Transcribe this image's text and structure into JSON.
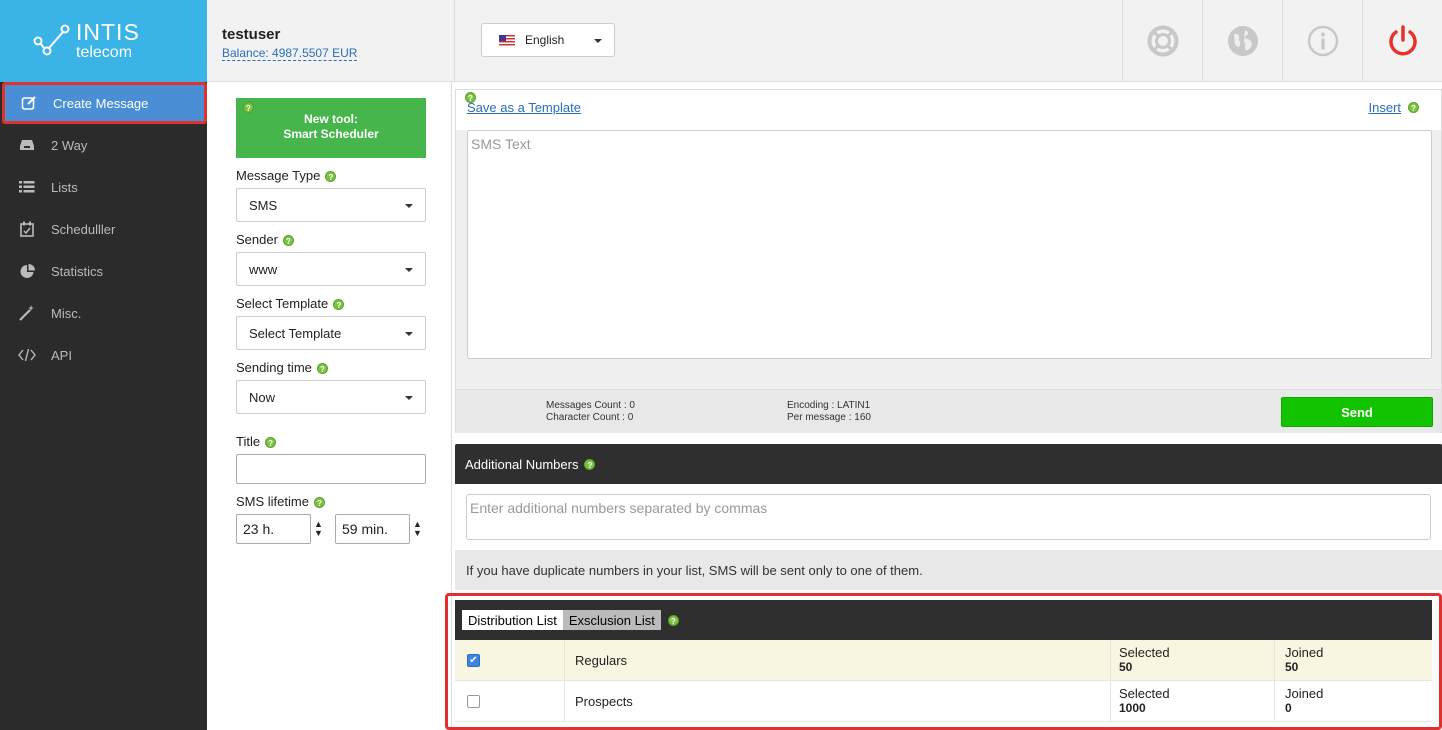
{
  "brand": {
    "name_line1": "INTIS",
    "name_line2": "telecom"
  },
  "sidebar": {
    "items": [
      {
        "label": "Create Message",
        "icon": "edit-icon"
      },
      {
        "label": "2 Way",
        "icon": "inbox-icon"
      },
      {
        "label": "Lists",
        "icon": "list-icon"
      },
      {
        "label": "Schedulller",
        "icon": "calendar-icon"
      },
      {
        "label": "Statistics",
        "icon": "pie-chart-icon"
      },
      {
        "label": "Misc.",
        "icon": "magic-wand-icon"
      },
      {
        "label": "API",
        "icon": "code-icon"
      }
    ]
  },
  "header": {
    "username": "testuser",
    "balance": "Balance: 4987.5507 EUR",
    "language": "English",
    "icons": [
      "lifebuoy-icon",
      "globe-icon",
      "info-icon",
      "power-icon"
    ]
  },
  "form": {
    "promo_line1": "New tool:",
    "promo_line2": "Smart Scheduler",
    "help_glyph": "?",
    "message_type_label": "Message Type",
    "message_type_value": "SMS",
    "sender_label": "Sender",
    "sender_value": "www",
    "template_label": "Select Template",
    "template_value": "Select Template",
    "sending_time_label": "Sending time",
    "sending_time_value": "Now",
    "title_label": "Title",
    "title_value": "",
    "lifetime_label": "SMS lifetime",
    "lifetime_hours": "23 h.",
    "lifetime_minutes": "59 min."
  },
  "editor": {
    "save_template": "Save as a Template",
    "insert": "Insert",
    "sms_placeholder": "SMS Text",
    "messages_count": "Messages Count : 0",
    "character_count": "Character Count : 0",
    "encoding": "Encoding : LATIN1",
    "per_message": "Per message : 160",
    "send": "Send"
  },
  "additional": {
    "title": "Additional Numbers",
    "placeholder": "Enter additional numbers separated by commas",
    "note": "If you have duplicate numbers in your list, SMS will be sent only to one of them."
  },
  "lists": {
    "tab_distribution": "Distribution List",
    "tab_exclusion": "Exsclusion List",
    "rows": [
      {
        "checked": true,
        "name": "Regulars",
        "selected_label": "Selected",
        "selected": "50",
        "joined_label": "Joined",
        "joined": "50"
      },
      {
        "checked": false,
        "name": "Prospects",
        "selected_label": "Selected",
        "selected": "1000",
        "joined_label": "Joined",
        "joined": "0"
      }
    ]
  },
  "colors": {
    "brand_blue": "#3ab3e6",
    "active_nav": "#4a8fd6",
    "send_green": "#12c400",
    "promo_green": "#46b54b",
    "highlight_red": "#e0312f"
  }
}
